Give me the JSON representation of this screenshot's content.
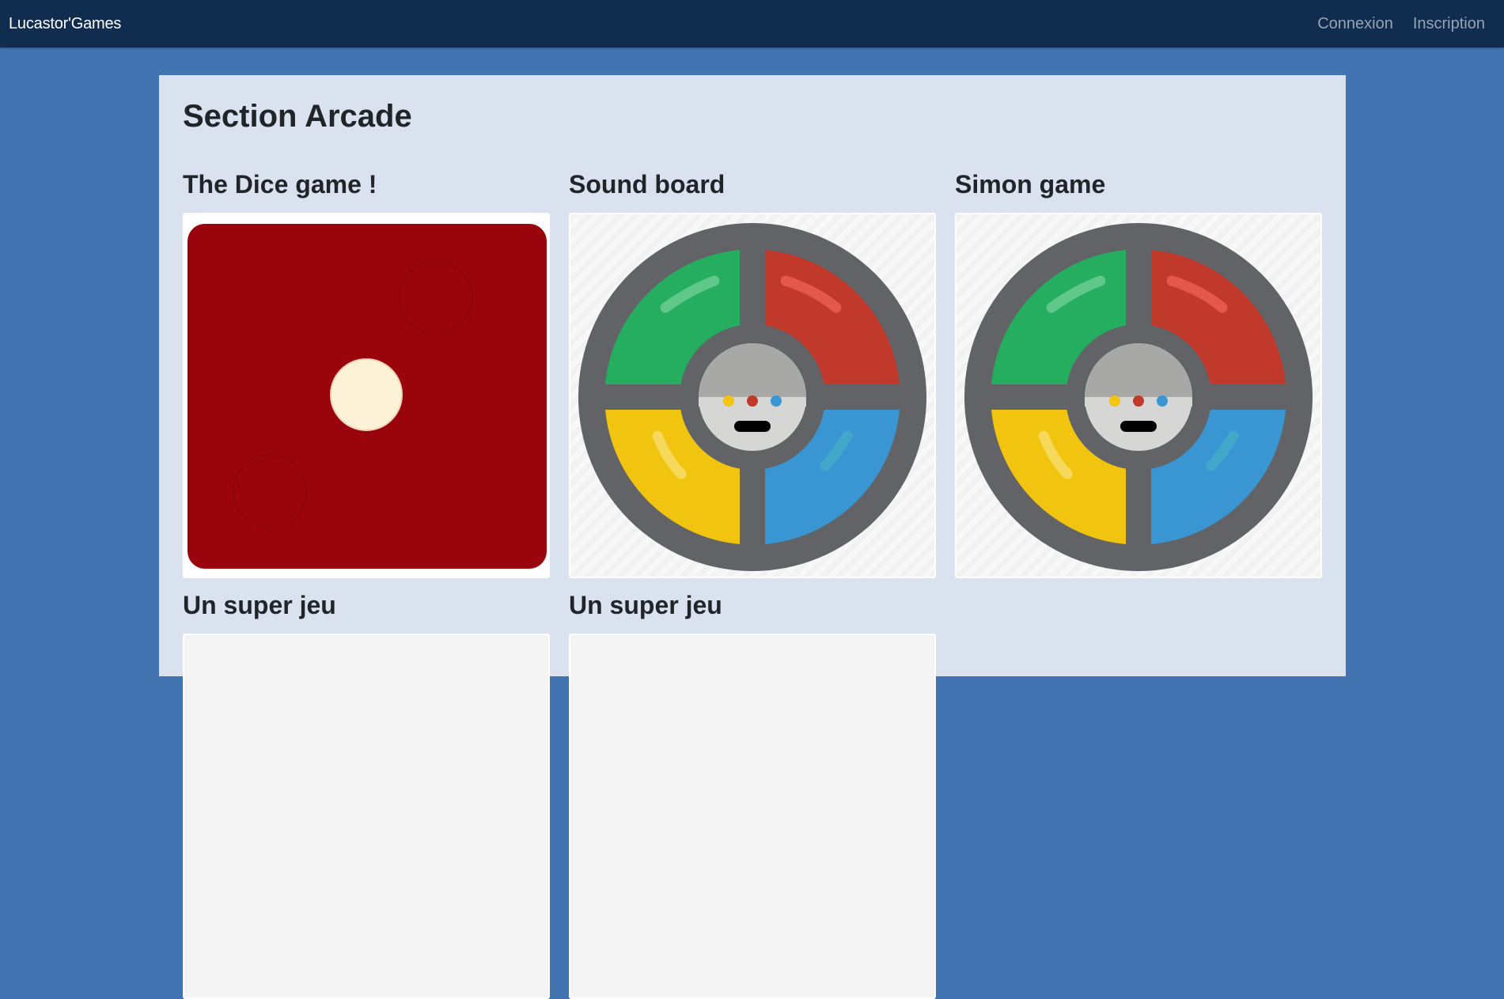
{
  "navbar": {
    "brand": "Lucastor'Games",
    "links": [
      {
        "label": "Connexion"
      },
      {
        "label": "Inscription"
      }
    ]
  },
  "page": {
    "title": "Section Arcade"
  },
  "games": [
    {
      "title": "The Dice game !",
      "image": "dice-face-one"
    },
    {
      "title": "Sound board",
      "image": "simon-toy"
    },
    {
      "title": "Simon game",
      "image": "simon-toy"
    },
    {
      "title": "Un super jeu",
      "image": "placeholder"
    },
    {
      "title": "Un super jeu",
      "image": "placeholder"
    }
  ],
  "colors": {
    "navbar_bg": "#102c4e",
    "page_bg": "#4374b2",
    "container_bg": "#dbe2ef",
    "dice_red": "#9a050d",
    "dice_pip": "#fdf1d8",
    "simon_green": "#25ae5f",
    "simon_red": "#c0392b",
    "simon_yellow": "#f1c40f",
    "simon_blue": "#3a95d3",
    "simon_body": "#626366"
  }
}
